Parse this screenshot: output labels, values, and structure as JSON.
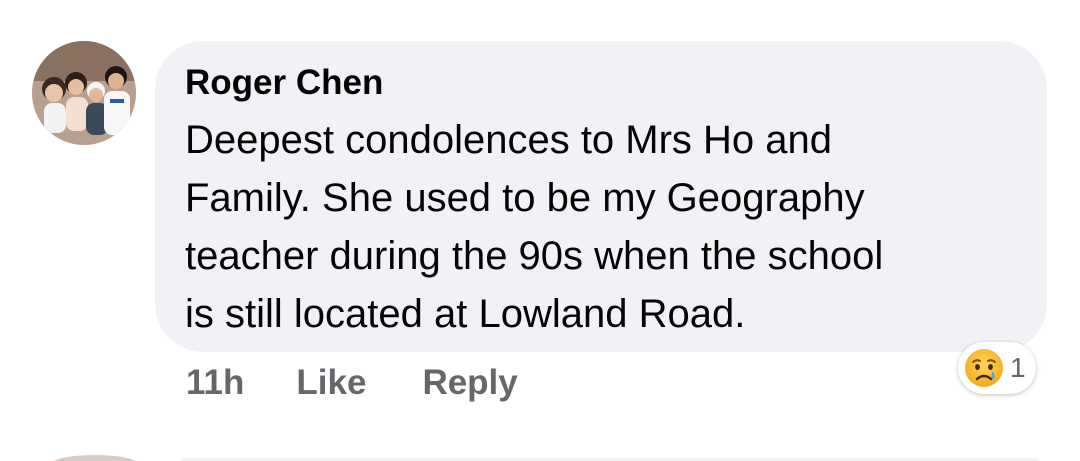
{
  "comment": {
    "author": "Roger Chen",
    "text": "Deepest condolences to Mrs Ho and\nFamily. She used to be my Geography\nteacher during the 90s when the school\nis still located at Lowland Road.",
    "timestamp": "11h",
    "like_label": "Like",
    "reply_label": "Reply",
    "reaction": {
      "icon": "sad-face-icon",
      "count": "1"
    }
  },
  "colors": {
    "bubble": "#f0f2f5",
    "text": "#050505",
    "secondary": "#65676b",
    "reaction_yellow": "#f7b125"
  }
}
